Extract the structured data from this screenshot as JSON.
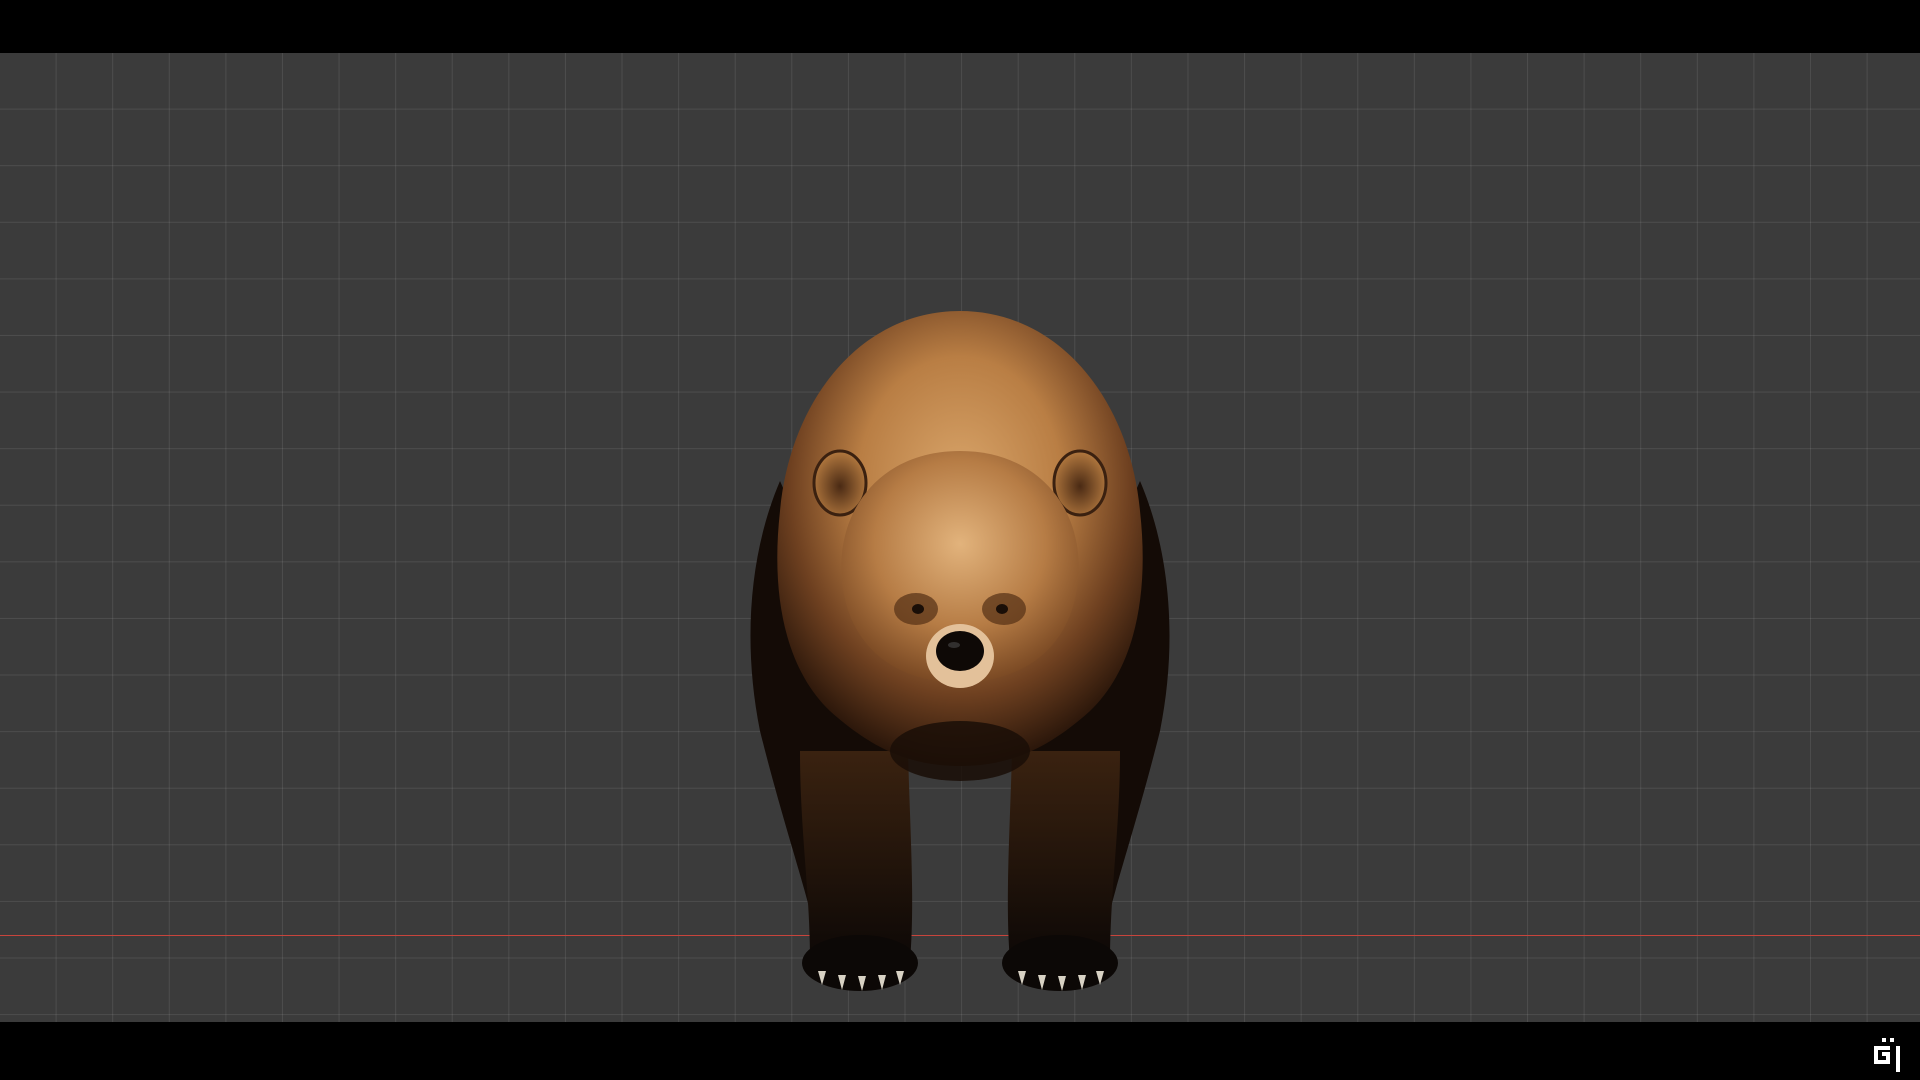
{
  "scene": {
    "subject_icon": "bear-model-icon",
    "grid_visible": true,
    "grid_color": "#5a5a5a",
    "background_color": "#3b3b3b",
    "ground_axis_color": "#c8443c",
    "letterbox_color": "#000000"
  },
  "overlay": {
    "logo_icon": "channel-logo-icon"
  }
}
